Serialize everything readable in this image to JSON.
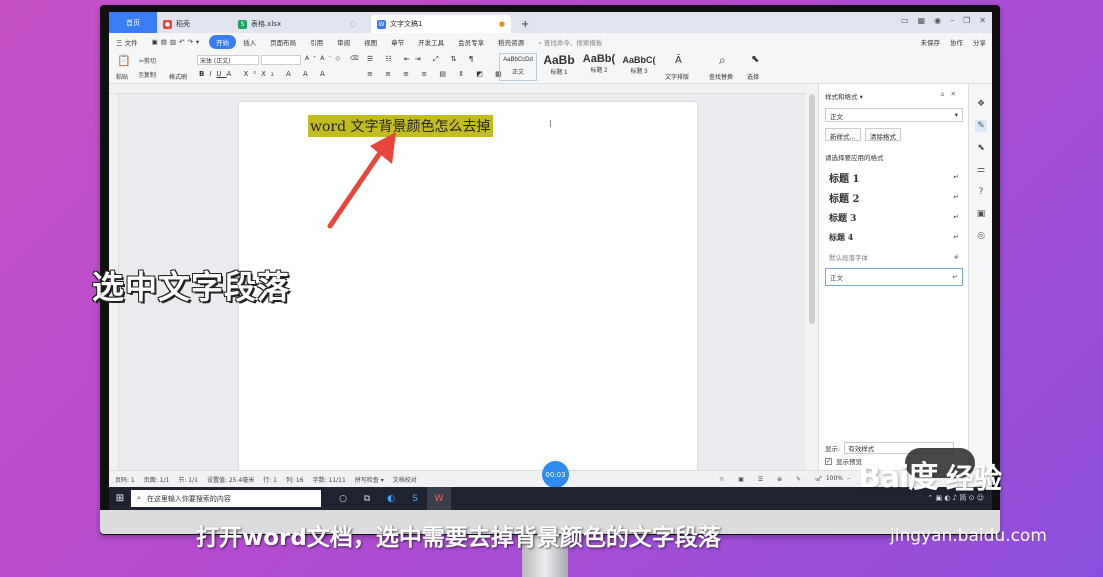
{
  "tabs": [
    {
      "label": "首页",
      "icon": ""
    },
    {
      "label": "稻壳",
      "icon": "daoke-icon"
    },
    {
      "label": "表格.xlsx",
      "icon": "sheet-icon"
    },
    {
      "label": "文字文稿1",
      "icon": "doc-icon"
    }
  ],
  "menu": [
    "三 文件",
    "开始",
    "插入",
    "页面布局",
    "引用",
    "审阅",
    "视图",
    "章节",
    "开发工具",
    "会员专享",
    "稻壳资源",
    "查找命令、搜索模板"
  ],
  "menu_right": [
    "未保存",
    "协作",
    "分享"
  ],
  "ribbon": {
    "cut": "剪切",
    "paste": "粘贴",
    "copy": "复制",
    "format_painter": "格式刷",
    "font": "宋体 (正文)",
    "styles": [
      {
        "preview": "AaBbCcDd",
        "label": "正文"
      },
      {
        "preview": "AaBb",
        "label": "标题 1"
      },
      {
        "preview": "AaBb(",
        "label": "标题 2"
      },
      {
        "preview": "AaBbC(",
        "label": "标题 3"
      }
    ],
    "text_layout": "文字排版",
    "find_replace": "查找替换",
    "select": "选择"
  },
  "document": {
    "highlighted_text": "word 文字背景颜色怎么去掉"
  },
  "pane": {
    "title": "样式和格式 ▾",
    "current_style": "正文",
    "new_style": "新样式...",
    "clear_format": "清除格式",
    "apply_label": "请选择要应用的格式",
    "styles": [
      "标题 1",
      "标题 2",
      "标题 3",
      "标题 4"
    ],
    "default_font": "默认段落字体",
    "normal": "正文",
    "show_label": "显示:",
    "show_value": "有效样式",
    "preview_label": "显示预览"
  },
  "status": [
    "页码: 1",
    "页面: 1/1",
    "节: 1/1",
    "设置值: 25.4毫米",
    "行: 1",
    "列: 16",
    "字数: 11/11",
    "拼写检查 ▾",
    "文档校对"
  ],
  "zoom": "100%",
  "timer": "00:03",
  "taskbar": {
    "search_placeholder": "在这里输入你要搜索的内容",
    "tray": "简"
  },
  "captions": {
    "left": "选中文字段落",
    "bottom": "打开word文档，选中需要去掉背景颜色的文字段落"
  },
  "watermark": {
    "logo": "Bai度",
    "jingyan": "经验",
    "url": "jingyan.baidu.com"
  },
  "colors": {
    "highlight": "#c3bc1e",
    "accent": "#3a7cf6",
    "arrow": "#e8463a"
  }
}
